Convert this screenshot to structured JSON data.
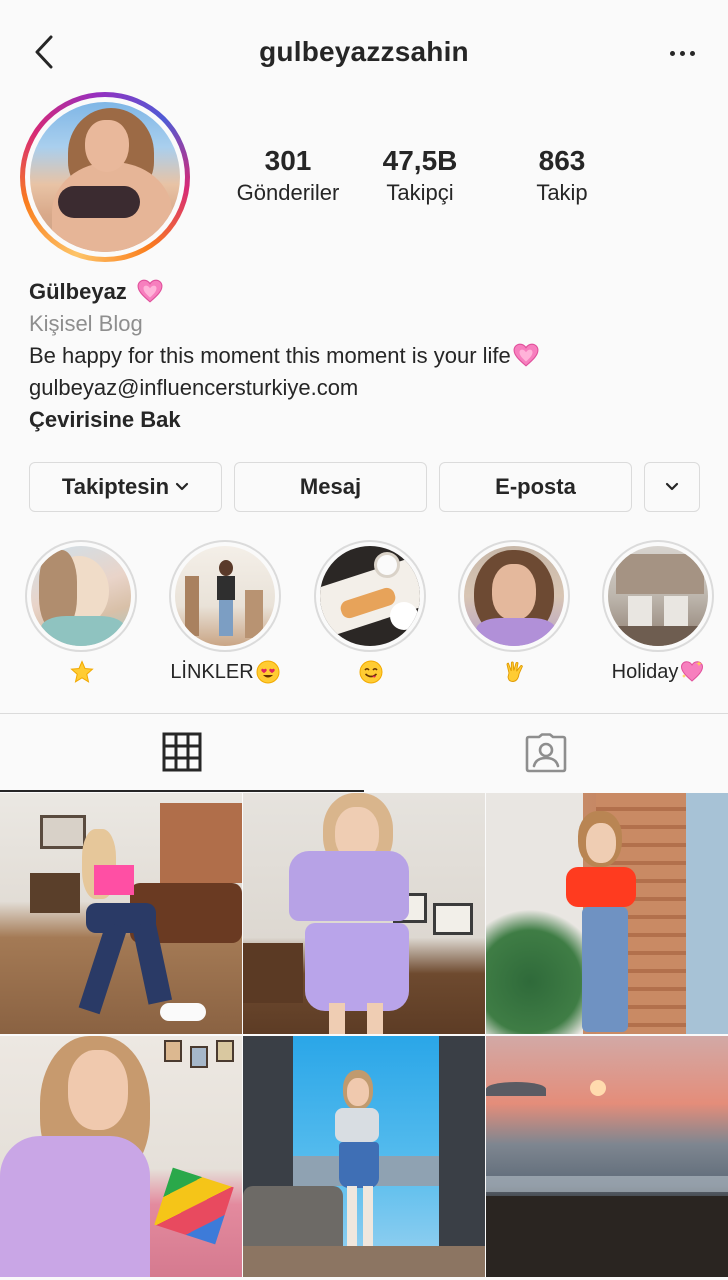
{
  "header": {
    "username": "gulbeyazzsahin",
    "back_icon": "chevron-left-icon",
    "more_icon": "more-horizontal-icon"
  },
  "profile": {
    "avatar_icon": "profile-avatar"
  },
  "stats": {
    "posts_count": "301",
    "posts_label": "Gönderiler",
    "followers_count": "47,5B",
    "followers_label": "Takipçi",
    "following_count": "863",
    "following_label": "Takip"
  },
  "bio": {
    "name": "Gülbeyaz",
    "category": "Kişisel Blog",
    "text": "Be happy for this moment this moment is your life",
    "email": "gulbeyaz@influencersturkiye.com",
    "translate": "Çevirisine Bak"
  },
  "buttons": {
    "following": "Takiptesin",
    "message": "Mesaj",
    "email": "E-posta"
  },
  "highlights": [
    {
      "label": "",
      "emoji": "star"
    },
    {
      "label": "LİNKLER",
      "emoji": "heart-eyes"
    },
    {
      "label": "",
      "emoji": "yum"
    },
    {
      "label": "",
      "emoji": "vulcan-hand"
    },
    {
      "label": "Holiday",
      "emoji": "sparkling-heart"
    }
  ],
  "tabs": {
    "grid_icon": "grid-icon",
    "tagged_icon": "tagged-icon"
  },
  "colors": {
    "text": "#262626",
    "secondary": "#8e8e8e",
    "border": "#dbdbdb",
    "heart": "#f77fbe"
  }
}
